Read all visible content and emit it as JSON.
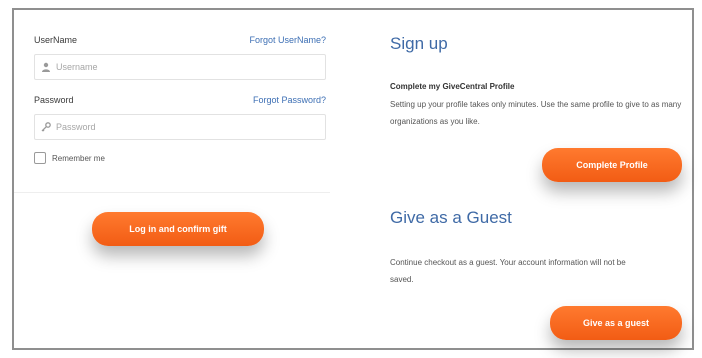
{
  "login": {
    "username_label": "UserName",
    "forgot_username": "Forgot UserName?",
    "username_placeholder": "Username",
    "password_label": "Password",
    "forgot_password": "Forgot Password?",
    "password_placeholder": "Password",
    "remember_label": "Remember me",
    "submit_label": "Log in and confirm gift"
  },
  "signup": {
    "title": "Sign up",
    "subtitle": "Complete my GiveCentral Profile",
    "description": "Setting up your profile takes only minutes. Use the same profile to give to as many organizations as you like.",
    "button_label": "Complete Profile"
  },
  "guest": {
    "title": "Give as a Guest",
    "description": "Continue checkout as a guest. Your account information will not be saved.",
    "button_label": "Give as a guest"
  },
  "colors": {
    "accent": "#f25c14",
    "link": "#3d6fb4",
    "heading": "#3f6aa6"
  },
  "icons": {
    "username": "user-icon",
    "password": "key-icon"
  }
}
